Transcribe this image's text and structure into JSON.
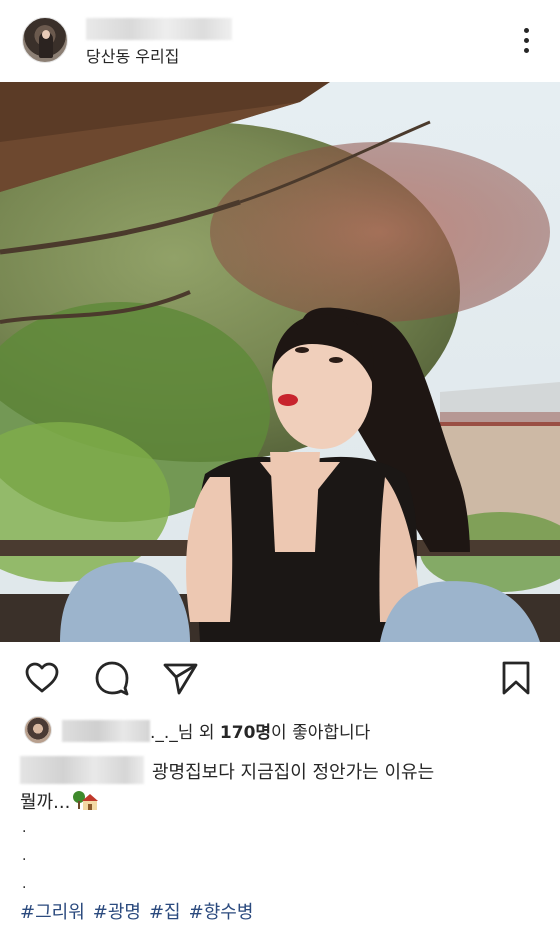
{
  "post": {
    "header": {
      "location": "당산동 우리집",
      "username_blurred": ""
    },
    "likes": {
      "liker_blurred": "",
      "suffix_before": "._._님 외 ",
      "count": "170명",
      "suffix_after": "이 좋아합니다"
    },
    "caption": {
      "author_blurred": "",
      "line1": "광명집보다 지금집이 정안가는 이유는",
      "line2": "뭘까...",
      "dots": [
        ".",
        ".",
        "."
      ],
      "hashtags": [
        "#그리워",
        "#광명",
        "#집",
        "#향수병"
      ]
    },
    "icons": {
      "like": "heart-icon",
      "comment": "comment-icon",
      "share": "send-icon",
      "save": "bookmark-icon",
      "more": "more-vertical-icon",
      "emoji": "house-with-tree-emoji"
    },
    "colors": {
      "hashtag": "#2b4a7e",
      "text": "#262626"
    }
  }
}
